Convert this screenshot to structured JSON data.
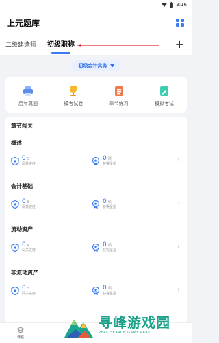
{
  "status_bar": {
    "time": "3:16"
  },
  "header": {
    "title": "上元题库"
  },
  "tabs": [
    {
      "label": "二级建造师"
    },
    {
      "label": "初级职称"
    }
  ],
  "subject": {
    "label": "初级会计实务"
  },
  "tools": [
    {
      "label": "历年真题",
      "icon": "printer-icon"
    },
    {
      "label": "模考试卷",
      "icon": "trophy-icon"
    },
    {
      "label": "章节练习",
      "icon": "list-icon"
    },
    {
      "label": "模拟考试",
      "icon": "edit-icon"
    }
  ],
  "chapters": {
    "heading": "章节闯关",
    "items": [
      {
        "name": "概述",
        "progress": "0",
        "progress_total": "5",
        "progress_caption": "闯关进度",
        "stars": "0",
        "stars_unit": "颗",
        "stars_caption": "获得星星"
      },
      {
        "name": "会计基础",
        "progress": "0",
        "progress_total": "8",
        "progress_caption": "闯关进度",
        "stars": "0",
        "stars_unit": "颗",
        "stars_caption": "获得星星"
      },
      {
        "name": "流动资产",
        "progress": "0",
        "progress_total": "4",
        "progress_caption": "闯关进度",
        "stars": "0",
        "stars_unit": "颗",
        "stars_caption": "获得星星"
      },
      {
        "name": "非流动资产",
        "progress": "0",
        "progress_total": "5",
        "progress_caption": "闯关进度",
        "stars": "0",
        "stars_unit": "颗",
        "stars_caption": "获得星星"
      }
    ]
  },
  "bottom_nav": [
    {
      "label": "课程"
    }
  ],
  "watermark": {
    "cn": "寻峰游戏园",
    "en": "PEAK SEARCH GAME PARK"
  },
  "colors": {
    "accent": "#3b7cf5",
    "arrow": "#d9232d",
    "watermark": "#19a089"
  }
}
